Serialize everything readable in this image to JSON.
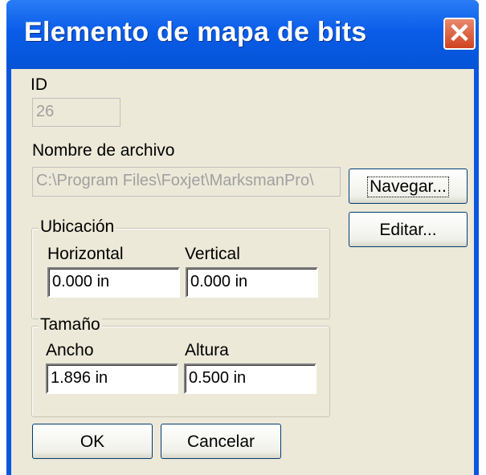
{
  "window": {
    "title": "Elemento de mapa de bits",
    "close_icon": "close-icon"
  },
  "id_section": {
    "label": "ID",
    "value": "26"
  },
  "file_section": {
    "label": "Nombre de archivo",
    "value": "C:\\Program Files\\Foxjet\\MarksmanPro\\",
    "browse_label": "Navegar...",
    "edit_label": "Editar..."
  },
  "location_group": {
    "legend": "Ubicación",
    "horizontal_label": "Horizontal",
    "horizontal_value": "0.000 in",
    "vertical_label": "Vertical",
    "vertical_value": "0.000 in"
  },
  "size_group": {
    "legend": "Tamaño",
    "width_label": "Ancho",
    "width_value": "1.896 in",
    "height_label": "Altura",
    "height_value": "0.500 in"
  },
  "buttons": {
    "ok_label": "OK",
    "cancel_label": "Cancelar"
  },
  "colors": {
    "title_bar": "#0a5de8",
    "close_button": "#d0421f",
    "dialog_face": "#ece9d8"
  }
}
